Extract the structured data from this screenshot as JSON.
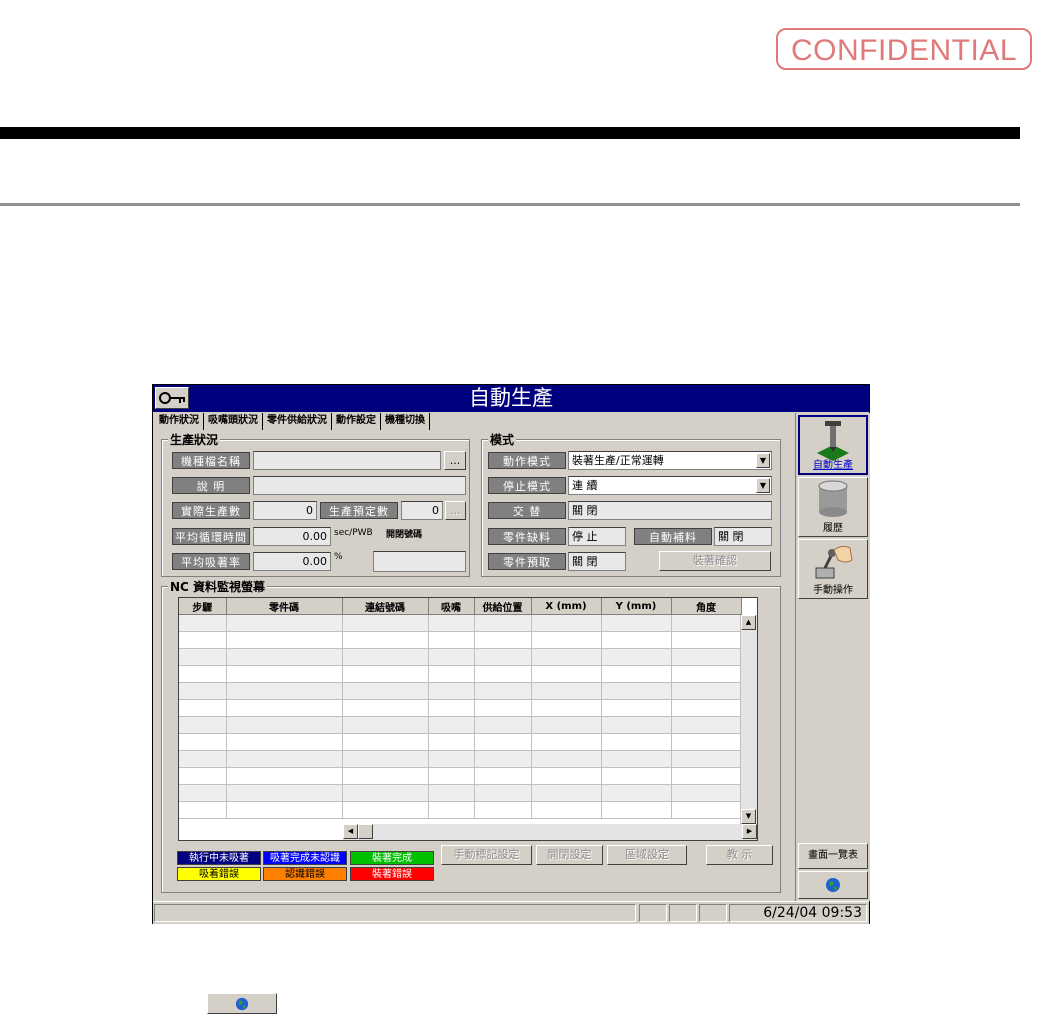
{
  "stamp": "CONFIDENTIAL",
  "window": {
    "title": "自動生產",
    "tabs": [
      "動作狀況",
      "吸嘴頭狀況",
      "零件供給狀況",
      "動作設定",
      "機種切換"
    ]
  },
  "production": {
    "legend": "生產狀況",
    "model_name_label": "機種檔名稱",
    "model_name_value": "",
    "browse_label": "...",
    "description_label": "說 明",
    "description_value": "",
    "actual_count_label": "實際生產數",
    "actual_count_value": "0",
    "planned_count_label": "生產預定數",
    "planned_count_value": "0",
    "planned_btn": "...",
    "avg_cycle_label": "平均循環時間",
    "avg_cycle_value": "0.00",
    "avg_cycle_unit": "sec/PWB",
    "panel_no_label": "開閉號碼",
    "avg_pick_label": "平均吸著率",
    "avg_pick_value": "0.00",
    "avg_pick_unit": "%",
    "extra_value": ""
  },
  "mode": {
    "legend": "模式",
    "action_mode_label": "動作模式",
    "action_mode_value": "裝著生產/正常運轉",
    "stop_mode_label": "停止模式",
    "stop_mode_value": "連 續",
    "alternate_label": "交 替",
    "alternate_value": "關 閉",
    "shortage_label": "零件缺料",
    "shortage_value": "停 止",
    "auto_feed_label": "自動補料",
    "auto_feed_value": "關 閉",
    "preload_label": "零件預取",
    "preload_value": "關 閉",
    "confirm_btn": "裝著確認"
  },
  "nc": {
    "legend": "NC 資料監視螢幕",
    "columns": [
      "步驟",
      "零件碼",
      "連結號碼",
      "吸嘴",
      "供給位置",
      "X (mm)",
      "Y (mm)",
      "角度"
    ],
    "row_count": 12
  },
  "status_legend": [
    {
      "label": "執行中未吸著",
      "bg": "#000080",
      "fg": "#ffffff"
    },
    {
      "label": "吸著完成未認識",
      "bg": "#0000ff",
      "fg": "#ffffff"
    },
    {
      "label": "裝著完成",
      "bg": "#00c000",
      "fg": "#ffffff"
    },
    {
      "label": "吸着錯誤",
      "bg": "#ffff00",
      "fg": "#000000"
    },
    {
      "label": "認識錯誤",
      "bg": "#ff8000",
      "fg": "#000000"
    },
    {
      "label": "裝著錯誤",
      "bg": "#ff0000",
      "fg": "#ffffff"
    }
  ],
  "actions": {
    "manual_mark": "手動標記設定",
    "panel_set": "開閉設定",
    "region_set": "區域設定",
    "teach": "教 示"
  },
  "side": {
    "auto_production": "自動生產",
    "history": "履歷",
    "manual_op": "手動操作",
    "screen_list": "畫面一覽表"
  },
  "statusbar": {
    "datetime": "6/24/04 09:53"
  },
  "colors": {
    "titlebar": "#00007f",
    "stamp": "#e07a7a",
    "face": "#d4d0c8"
  }
}
